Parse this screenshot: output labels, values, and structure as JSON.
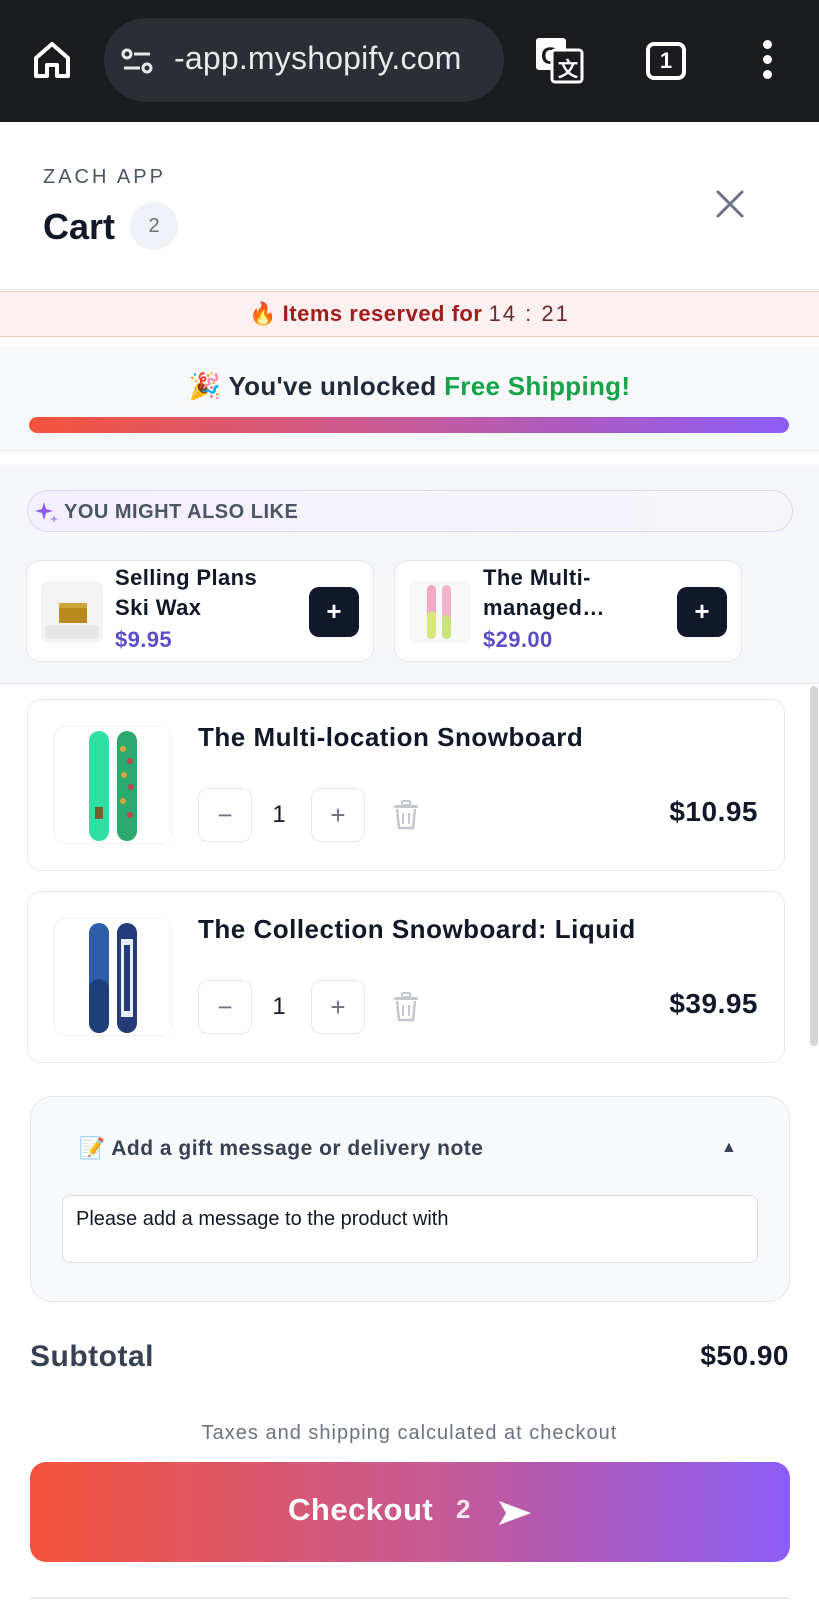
{
  "browser": {
    "url": "-app.myshopify.com",
    "tab_count": "1"
  },
  "header": {
    "store_name": "ZACH APP",
    "title": "Cart",
    "count": "2"
  },
  "reserved": {
    "icon": "🔥",
    "text": "Items reserved for",
    "timer": "14 : 21"
  },
  "shipping": {
    "icon": "🎉",
    "text": "You've unlocked",
    "highlight": "Free Shipping!",
    "progress_fraction": 1.0
  },
  "upsell": {
    "label": "YOU MIGHT ALSO LIKE",
    "products": [
      {
        "name": "Selling Plans Ski Wax",
        "price": "$9.95",
        "add_label": "+"
      },
      {
        "name": "The Multi-managed…",
        "price": "$29.00",
        "add_label": "+"
      }
    ]
  },
  "items": [
    {
      "title": "The Multi-location Snowboard",
      "qty": "1",
      "minus": "−",
      "plus": "+",
      "price": "$10.95"
    },
    {
      "title": "The Collection Snowboard: Liquid",
      "qty": "1",
      "minus": "−",
      "plus": "+",
      "price": "$39.95"
    }
  ],
  "note": {
    "icon": "📝",
    "heading": "Add a gift message or delivery note",
    "caret": "▲",
    "value": "Please add a message to the product with"
  },
  "summary": {
    "subtotal_label": "Subtotal",
    "subtotal_value": "$50.90",
    "tax_note": "Taxes and shipping calculated at checkout"
  },
  "checkout": {
    "label": "Checkout",
    "count": "2"
  },
  "colors": {
    "accent_start": "#f4533a",
    "accent_end": "#8b5cf6",
    "success": "#16a34a",
    "price": "#5b4fc9",
    "urgency": "#a11d1d"
  }
}
